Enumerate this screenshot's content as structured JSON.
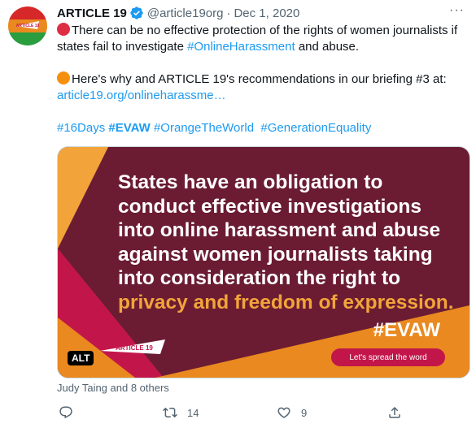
{
  "tweet": {
    "author_name": "ARTICLE 19",
    "handle": "@article19org",
    "separator": "·",
    "date": "Dec 1, 2020",
    "more_label": "···",
    "line1_text": "There can be no effective protection of the rights of women journalists if states fail to investigate ",
    "line1_hashtag": "#OnlineHarassment",
    "line1_end": " and abuse.",
    "line2_text": "Here's why and ARTICLE 19's recommendations in our briefing #3 at: ",
    "line2_link": "article19.org/onlineharassme…",
    "hashtags": [
      "#16Days",
      "#EVAW",
      "#OrangeTheWorld",
      "#GenerationEquality"
    ],
    "emoji_colors": {
      "first": "#dd2e44",
      "second": "#f4900c"
    },
    "verified_color": "#1d9bf0"
  },
  "media": {
    "main_text": "States have an obligation to conduct effective investigations into online harassment and abuse against women journalists taking into consideration the right to ",
    "highlight_text": "privacy and freedom of expression.",
    "hashtag": "#EVAW",
    "button_label": "Let's spread the word",
    "alt_badge": "ALT",
    "brand_logo_text": "ARTICLE 19",
    "colors": {
      "background": "#6b1c33",
      "accent_orange": "#e9891f",
      "accent_yellow": "#f2a43a",
      "accent_pink": "#c2164a"
    }
  },
  "avatar": {
    "logo_text": "ARTICLE 19",
    "stripe_colors": [
      "#d62828",
      "#e9891f",
      "#2a9d3f"
    ]
  },
  "likers_text": "Judy Taing and 8 others",
  "actions": {
    "reply": {
      "icon": "reply-icon"
    },
    "retweet": {
      "icon": "retweet-icon",
      "count": "14"
    },
    "like": {
      "icon": "heart-icon",
      "count": "9"
    },
    "share": {
      "icon": "share-icon"
    }
  }
}
